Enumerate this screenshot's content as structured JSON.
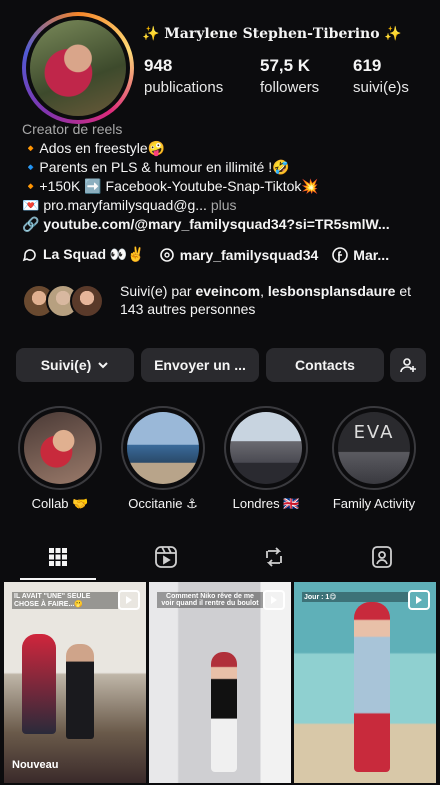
{
  "profile": {
    "name": "✨ 𝐌𝐚𝐫𝐲𝐥𝐞𝐧𝐞 𝐒𝐭𝐞𝐩𝐡𝐞𝐧-𝐓𝐢𝐛𝐞𝐫𝐢𝐧𝐨 ✨",
    "stats": [
      {
        "value": "948",
        "label": "publications"
      },
      {
        "value": "57,5 K",
        "label": "followers"
      },
      {
        "value": "619",
        "label": "suivi(e)s"
      }
    ]
  },
  "bio": {
    "category": "Creator de reels",
    "lines": [
      "🔸Ados en freestyle🤪",
      "🔹Parents en PLS & humour en illimité !🤣",
      "🔸+150K ➡️ Facebook-Youtube-Snap-Tiktok💥",
      "💌 pro.maryfamilysquad@g..."
    ],
    "more": "plus",
    "link": "youtube.com/@mary_familysquad34?si=TR5smlW..."
  },
  "chips": [
    {
      "label": "La Squad 👀✌️"
    },
    {
      "label": "mary_familysquad34"
    },
    {
      "label": "Mar..."
    }
  ],
  "mutual": {
    "prefix": "Suivi(e) par ",
    "name1": "eveincom",
    "sep": ",",
    "name2": "lesbonsplansdaure",
    "suffix": " et 143 autres personnes"
  },
  "buttons": {
    "following": "Suivi(e)",
    "message": "Envoyer un ...",
    "contacts": "Contacts"
  },
  "highlights": [
    {
      "label": "Collab 🤝"
    },
    {
      "label": "Occitanie ⚓"
    },
    {
      "label": "Londres 🇬🇧"
    },
    {
      "label": "Family Activity"
    }
  ],
  "highlight_texts": {
    "eva": "EVA"
  },
  "posts": [
    {
      "caption": "IL AVAIT \"UNE\" SEULE CHOSE À FAIRE...🫢",
      "badge": "Nouveau"
    },
    {
      "caption": "Comment Niko rêve de me voir quand il rentre du boulot"
    },
    {
      "caption": "Jour : 1😋"
    }
  ]
}
